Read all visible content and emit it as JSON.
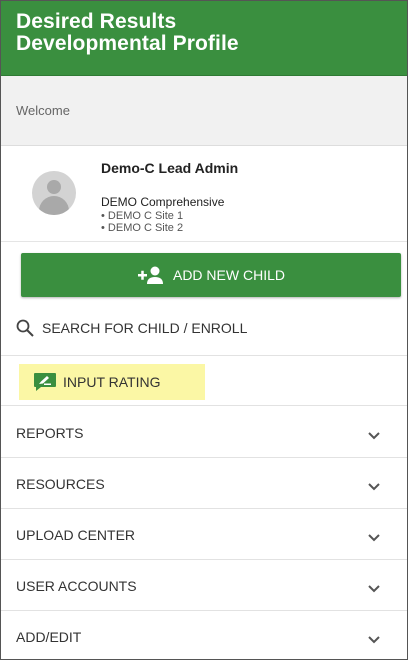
{
  "header": {
    "title_line1": "Desired Results",
    "title_line2": "Developmental Profile"
  },
  "welcome": "Welcome",
  "profile": {
    "name": "Demo-C Lead Admin",
    "organization": "DEMO Comprehensive",
    "sites": [
      "• DEMO C Site 1",
      "• DEMO C Site 2"
    ]
  },
  "actions": {
    "add_child": "ADD NEW CHILD",
    "search": "SEARCH FOR CHILD / ENROLL",
    "input_rating": "INPUT RATING"
  },
  "menu": [
    {
      "label": "REPORTS"
    },
    {
      "label": "RESOURCES"
    },
    {
      "label": "UPLOAD CENTER"
    },
    {
      "label": "USER ACCOUNTS"
    },
    {
      "label": "ADD/EDIT"
    }
  ],
  "colors": {
    "brand_green": "#3a8f3f",
    "highlight": "#fbf7a5"
  }
}
